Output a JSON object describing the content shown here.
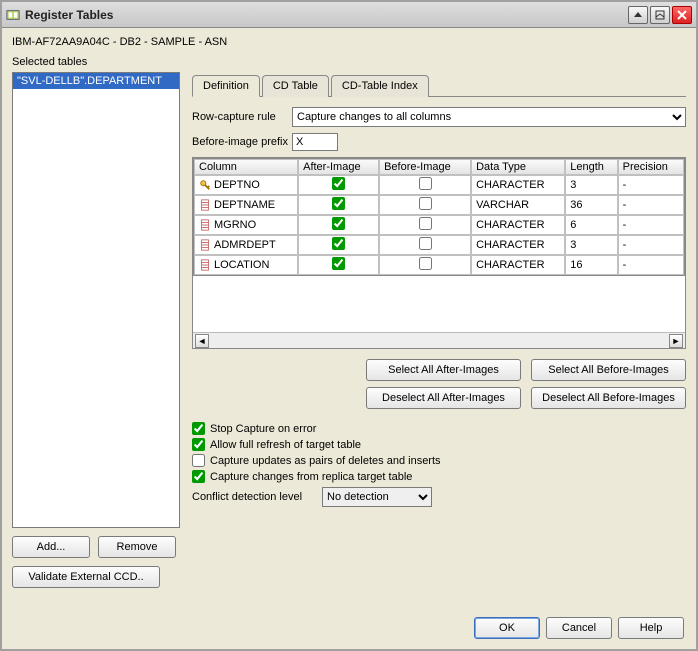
{
  "window": {
    "title": "Register Tables"
  },
  "breadcrumb": "IBM-AF72AA9A04C - DB2 - SAMPLE - ASN",
  "selected_tables_label": "Selected tables",
  "selected_tables": [
    "\"SVL-DELLB\".DEPARTMENT"
  ],
  "tabs": [
    "Definition",
    "CD Table",
    "CD-Table Index"
  ],
  "active_tab": 0,
  "row_capture": {
    "label": "Row-capture rule",
    "value": "Capture changes to all columns",
    "options": [
      "Capture changes to all columns"
    ]
  },
  "before_image_prefix": {
    "label": "Before-image prefix",
    "value": "X"
  },
  "grid": {
    "headers": [
      "Column",
      "After-Image",
      "Before-Image",
      "Data Type",
      "Length",
      "Precision"
    ],
    "rows": [
      {
        "is_key": true,
        "name": "DEPTNO",
        "after": true,
        "before": false,
        "datatype": "CHARACTER",
        "length": "3",
        "precision": "-"
      },
      {
        "is_key": false,
        "name": "DEPTNAME",
        "after": true,
        "before": false,
        "datatype": "VARCHAR",
        "length": "36",
        "precision": "-"
      },
      {
        "is_key": false,
        "name": "MGRNO",
        "after": true,
        "before": false,
        "datatype": "CHARACTER",
        "length": "6",
        "precision": "-"
      },
      {
        "is_key": false,
        "name": "ADMRDEPT",
        "after": true,
        "before": false,
        "datatype": "CHARACTER",
        "length": "3",
        "precision": "-"
      },
      {
        "is_key": false,
        "name": "LOCATION",
        "after": true,
        "before": false,
        "datatype": "CHARACTER",
        "length": "16",
        "precision": "-"
      }
    ]
  },
  "image_buttons": {
    "sel_after": "Select All After-Images",
    "desel_after": "Deselect All After-Images",
    "sel_before": "Select All Before-Images",
    "desel_before": "Deselect All Before-Images"
  },
  "options": {
    "stop_on_error": {
      "checked": true,
      "label": "Stop Capture on error"
    },
    "full_refresh": {
      "checked": true,
      "label": "Allow full refresh of target table"
    },
    "pairs": {
      "checked": false,
      "label": "Capture updates as pairs of deletes and inserts"
    },
    "replica": {
      "checked": true,
      "label": "Capture changes from replica target table"
    }
  },
  "conflict": {
    "label": "Conflict detection level",
    "value": "No detection",
    "options": [
      "No detection"
    ]
  },
  "left_buttons": {
    "add": "Add...",
    "remove": "Remove",
    "validate": "Validate External CCD.."
  },
  "dialog_buttons": {
    "ok": "OK",
    "cancel": "Cancel",
    "help": "Help"
  }
}
